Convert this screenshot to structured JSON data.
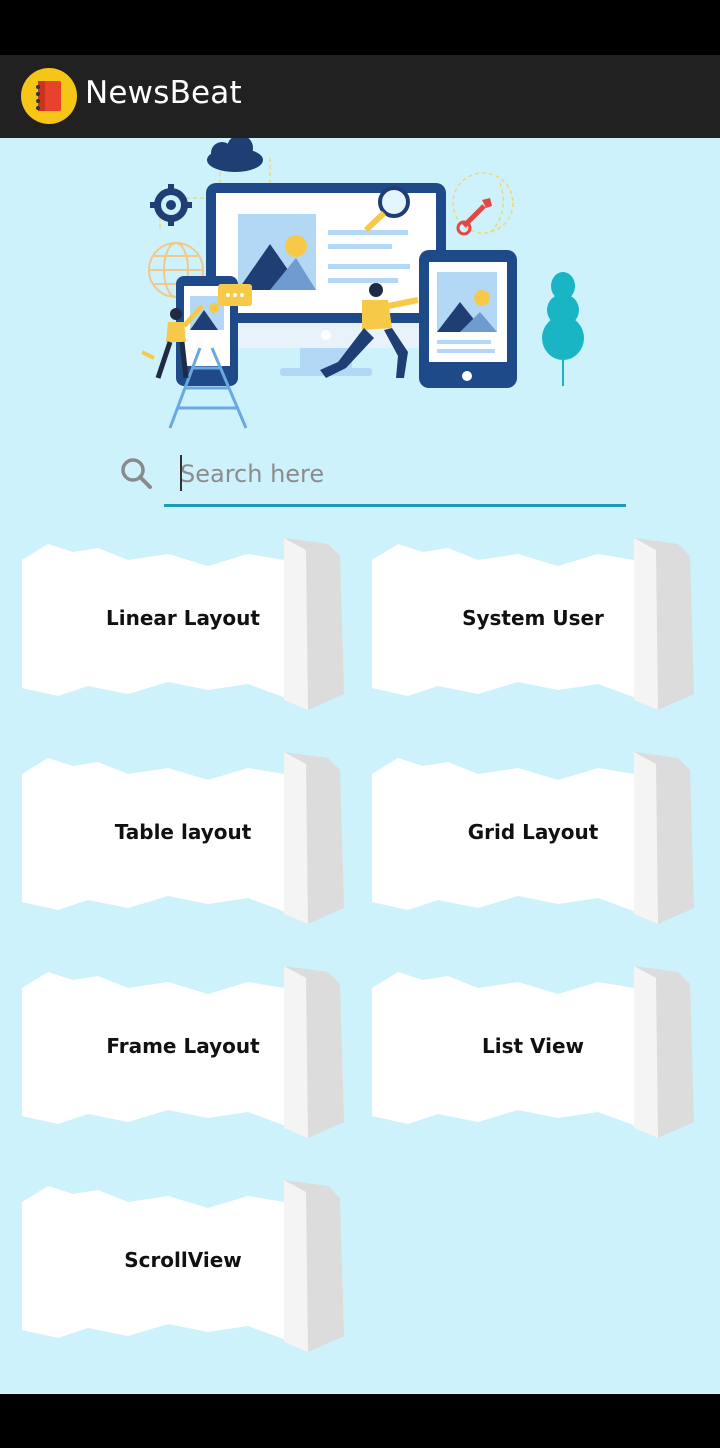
{
  "app": {
    "title": "NewsBeat",
    "logo_icon": "notebook-icon"
  },
  "colors": {
    "app_bar": "#212121",
    "background": "#cdf2fb",
    "accent": "#1e9ab7",
    "logo_bg": "#f5c518"
  },
  "search": {
    "placeholder": "Search here",
    "value": "",
    "icon": "search-icon"
  },
  "cards": [
    {
      "label": "Linear Layout"
    },
    {
      "label": "System User"
    },
    {
      "label": "Table layout"
    },
    {
      "label": "Grid Layout"
    },
    {
      "label": "Frame Layout"
    },
    {
      "label": "List View"
    },
    {
      "label": "ScrollView"
    }
  ]
}
